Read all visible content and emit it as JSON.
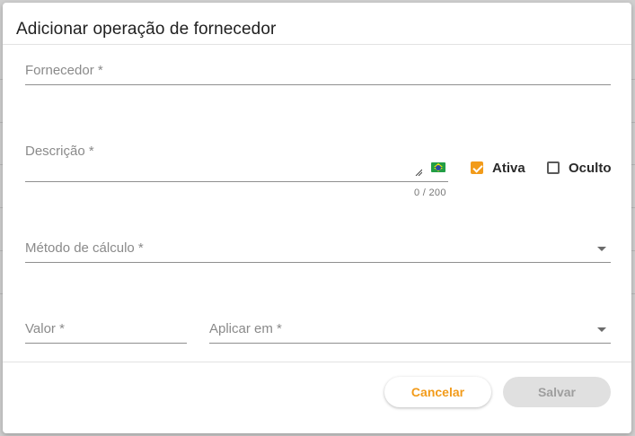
{
  "dialog": {
    "title": "Adicionar operação de fornecedor"
  },
  "form": {
    "supplier": {
      "label": "Fornecedor *",
      "value": ""
    },
    "description": {
      "label": "Descrição *",
      "value": "",
      "counter": "0 / 200",
      "language_flag": "brazil-flag-icon"
    },
    "active": {
      "label": "Ativa",
      "checked": true
    },
    "hidden": {
      "label": "Oculto",
      "checked": false
    },
    "calc_method": {
      "label": "Método de cálculo *",
      "value": ""
    },
    "value": {
      "label": "Valor *",
      "value": ""
    },
    "apply_on": {
      "label": "Aplicar em *",
      "value": ""
    }
  },
  "actions": {
    "cancel_label": "Cancelar",
    "save_label": "Salvar"
  },
  "colors": {
    "accent": "#f29b1a",
    "disabled_bg": "#e0e0e0",
    "disabled_text": "#9e9e9e"
  }
}
